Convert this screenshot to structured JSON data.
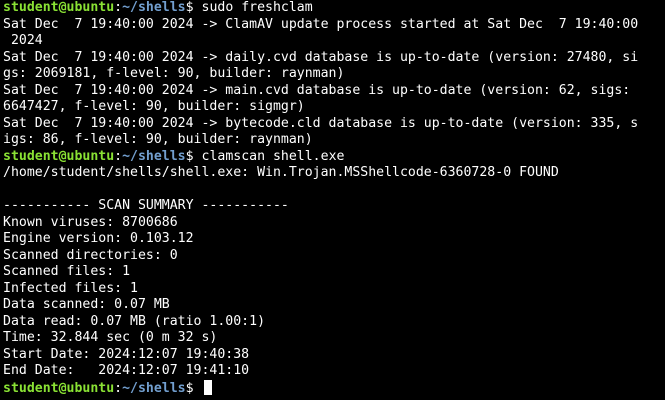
{
  "prompt": {
    "user": "student@ubuntu",
    "sep": ":",
    "path": "~/shells",
    "dollar": "$ "
  },
  "commands": {
    "freshclam": "sudo freshclam",
    "clamscan": "clamscan shell.exe"
  },
  "freshclam_output": [
    "Sat Dec  7 19:40:00 2024 -> ClamAV update process started at Sat Dec  7 19:40:00",
    " 2024",
    "Sat Dec  7 19:40:00 2024 -> daily.cvd database is up-to-date (version: 27480, si",
    "gs: 2069181, f-level: 90, builder: raynman)",
    "Sat Dec  7 19:40:00 2024 -> main.cvd database is up-to-date (version: 62, sigs:",
    "6647427, f-level: 90, builder: sigmgr)",
    "Sat Dec  7 19:40:00 2024 -> bytecode.cld database is up-to-date (version: 335, s",
    "igs: 86, f-level: 90, builder: raynman)"
  ],
  "clamscan_output": [
    "/home/student/shells/shell.exe: Win.Trojan.MSShellcode-6360728-0 FOUND",
    "",
    "----------- SCAN SUMMARY -----------",
    "Known viruses: 8700686",
    "Engine version: 0.103.12",
    "Scanned directories: 0",
    "Scanned files: 1",
    "Infected files: 1",
    "Data scanned: 0.07 MB",
    "Data read: 0.07 MB (ratio 1.00:1)",
    "Time: 32.844 sec (0 m 32 s)",
    "Start Date: 2024:12:07 19:40:38",
    "End Date:   2024:12:07 19:41:10"
  ]
}
